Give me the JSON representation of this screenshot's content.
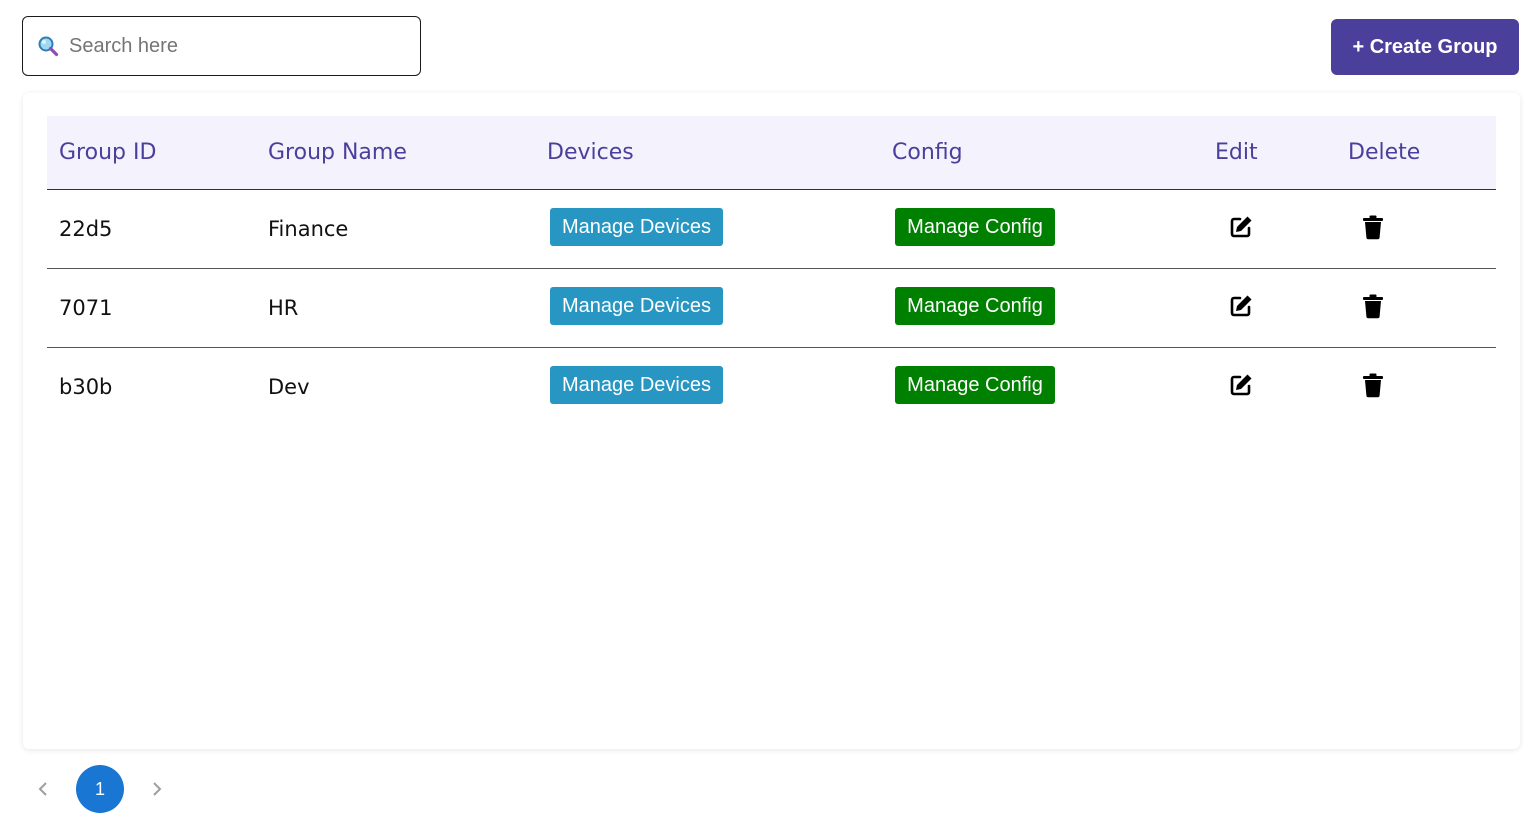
{
  "search": {
    "placeholder": "Search here",
    "icon": "search-icon"
  },
  "toolbar": {
    "create_label": "+ Create Group"
  },
  "table": {
    "headers": {
      "group_id": "Group ID",
      "group_name": "Group Name",
      "devices": "Devices",
      "config": "Config",
      "edit": "Edit",
      "delete": "Delete"
    },
    "rows": [
      {
        "group_id": "22d5",
        "group_name": "Finance",
        "devices_label": "Manage Devices",
        "config_label": "Manage Config",
        "edit_icon": "edit-icon",
        "delete_icon": "trash-icon"
      },
      {
        "group_id": "7071",
        "group_name": "HR",
        "devices_label": "Manage Devices",
        "config_label": "Manage Config",
        "edit_icon": "edit-icon",
        "delete_icon": "trash-icon"
      },
      {
        "group_id": "b30b",
        "group_name": "Dev",
        "devices_label": "Manage Devices",
        "config_label": "Manage Config",
        "edit_icon": "edit-icon",
        "delete_icon": "trash-icon"
      }
    ]
  },
  "pagination": {
    "current_page": "1",
    "prev_icon": "chevron-left-icon",
    "next_icon": "chevron-right-icon"
  },
  "colors": {
    "accent": "#4b3f9c",
    "header_bg": "#f4f2fd",
    "devices_button": "#2796c2",
    "config_button": "#008000",
    "page_active": "#1976d2"
  }
}
